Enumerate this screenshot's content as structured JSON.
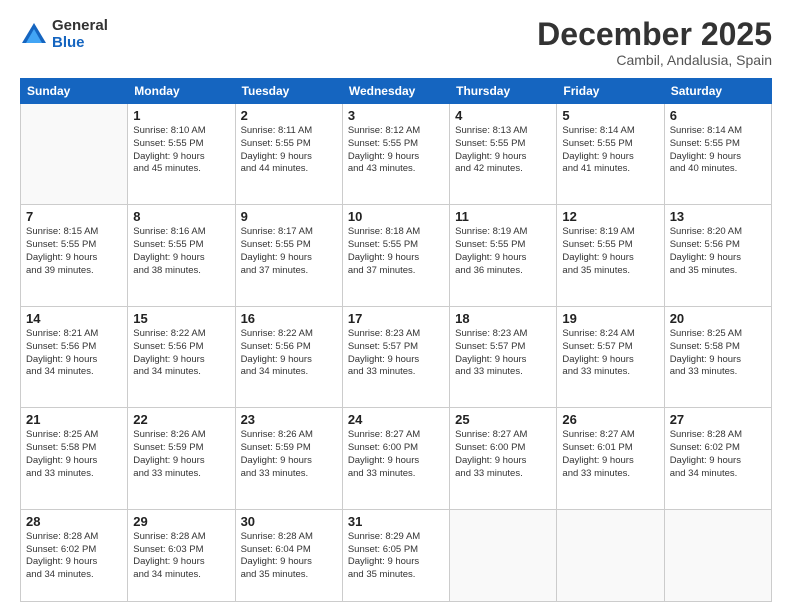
{
  "logo": {
    "general": "General",
    "blue": "Blue"
  },
  "header": {
    "month": "December 2025",
    "location": "Cambil, Andalusia, Spain"
  },
  "weekdays": [
    "Sunday",
    "Monday",
    "Tuesday",
    "Wednesday",
    "Thursday",
    "Friday",
    "Saturday"
  ],
  "weeks": [
    [
      {
        "day": null
      },
      {
        "day": "1",
        "sunrise": "Sunrise: 8:10 AM",
        "sunset": "Sunset: 5:55 PM",
        "daylight": "Daylight: 9 hours and 45 minutes."
      },
      {
        "day": "2",
        "sunrise": "Sunrise: 8:11 AM",
        "sunset": "Sunset: 5:55 PM",
        "daylight": "Daylight: 9 hours and 44 minutes."
      },
      {
        "day": "3",
        "sunrise": "Sunrise: 8:12 AM",
        "sunset": "Sunset: 5:55 PM",
        "daylight": "Daylight: 9 hours and 43 minutes."
      },
      {
        "day": "4",
        "sunrise": "Sunrise: 8:13 AM",
        "sunset": "Sunset: 5:55 PM",
        "daylight": "Daylight: 9 hours and 42 minutes."
      },
      {
        "day": "5",
        "sunrise": "Sunrise: 8:14 AM",
        "sunset": "Sunset: 5:55 PM",
        "daylight": "Daylight: 9 hours and 41 minutes."
      },
      {
        "day": "6",
        "sunrise": "Sunrise: 8:14 AM",
        "sunset": "Sunset: 5:55 PM",
        "daylight": "Daylight: 9 hours and 40 minutes."
      }
    ],
    [
      {
        "day": "7",
        "sunrise": "Sunrise: 8:15 AM",
        "sunset": "Sunset: 5:55 PM",
        "daylight": "Daylight: 9 hours and 39 minutes."
      },
      {
        "day": "8",
        "sunrise": "Sunrise: 8:16 AM",
        "sunset": "Sunset: 5:55 PM",
        "daylight": "Daylight: 9 hours and 38 minutes."
      },
      {
        "day": "9",
        "sunrise": "Sunrise: 8:17 AM",
        "sunset": "Sunset: 5:55 PM",
        "daylight": "Daylight: 9 hours and 37 minutes."
      },
      {
        "day": "10",
        "sunrise": "Sunrise: 8:18 AM",
        "sunset": "Sunset: 5:55 PM",
        "daylight": "Daylight: 9 hours and 37 minutes."
      },
      {
        "day": "11",
        "sunrise": "Sunrise: 8:19 AM",
        "sunset": "Sunset: 5:55 PM",
        "daylight": "Daylight: 9 hours and 36 minutes."
      },
      {
        "day": "12",
        "sunrise": "Sunrise: 8:19 AM",
        "sunset": "Sunset: 5:55 PM",
        "daylight": "Daylight: 9 hours and 35 minutes."
      },
      {
        "day": "13",
        "sunrise": "Sunrise: 8:20 AM",
        "sunset": "Sunset: 5:56 PM",
        "daylight": "Daylight: 9 hours and 35 minutes."
      }
    ],
    [
      {
        "day": "14",
        "sunrise": "Sunrise: 8:21 AM",
        "sunset": "Sunset: 5:56 PM",
        "daylight": "Daylight: 9 hours and 34 minutes."
      },
      {
        "day": "15",
        "sunrise": "Sunrise: 8:22 AM",
        "sunset": "Sunset: 5:56 PM",
        "daylight": "Daylight: 9 hours and 34 minutes."
      },
      {
        "day": "16",
        "sunrise": "Sunrise: 8:22 AM",
        "sunset": "Sunset: 5:56 PM",
        "daylight": "Daylight: 9 hours and 34 minutes."
      },
      {
        "day": "17",
        "sunrise": "Sunrise: 8:23 AM",
        "sunset": "Sunset: 5:57 PM",
        "daylight": "Daylight: 9 hours and 33 minutes."
      },
      {
        "day": "18",
        "sunrise": "Sunrise: 8:23 AM",
        "sunset": "Sunset: 5:57 PM",
        "daylight": "Daylight: 9 hours and 33 minutes."
      },
      {
        "day": "19",
        "sunrise": "Sunrise: 8:24 AM",
        "sunset": "Sunset: 5:57 PM",
        "daylight": "Daylight: 9 hours and 33 minutes."
      },
      {
        "day": "20",
        "sunrise": "Sunrise: 8:25 AM",
        "sunset": "Sunset: 5:58 PM",
        "daylight": "Daylight: 9 hours and 33 minutes."
      }
    ],
    [
      {
        "day": "21",
        "sunrise": "Sunrise: 8:25 AM",
        "sunset": "Sunset: 5:58 PM",
        "daylight": "Daylight: 9 hours and 33 minutes."
      },
      {
        "day": "22",
        "sunrise": "Sunrise: 8:26 AM",
        "sunset": "Sunset: 5:59 PM",
        "daylight": "Daylight: 9 hours and 33 minutes."
      },
      {
        "day": "23",
        "sunrise": "Sunrise: 8:26 AM",
        "sunset": "Sunset: 5:59 PM",
        "daylight": "Daylight: 9 hours and 33 minutes."
      },
      {
        "day": "24",
        "sunrise": "Sunrise: 8:27 AM",
        "sunset": "Sunset: 6:00 PM",
        "daylight": "Daylight: 9 hours and 33 minutes."
      },
      {
        "day": "25",
        "sunrise": "Sunrise: 8:27 AM",
        "sunset": "Sunset: 6:00 PM",
        "daylight": "Daylight: 9 hours and 33 minutes."
      },
      {
        "day": "26",
        "sunrise": "Sunrise: 8:27 AM",
        "sunset": "Sunset: 6:01 PM",
        "daylight": "Daylight: 9 hours and 33 minutes."
      },
      {
        "day": "27",
        "sunrise": "Sunrise: 8:28 AM",
        "sunset": "Sunset: 6:02 PM",
        "daylight": "Daylight: 9 hours and 34 minutes."
      }
    ],
    [
      {
        "day": "28",
        "sunrise": "Sunrise: 8:28 AM",
        "sunset": "Sunset: 6:02 PM",
        "daylight": "Daylight: 9 hours and 34 minutes."
      },
      {
        "day": "29",
        "sunrise": "Sunrise: 8:28 AM",
        "sunset": "Sunset: 6:03 PM",
        "daylight": "Daylight: 9 hours and 34 minutes."
      },
      {
        "day": "30",
        "sunrise": "Sunrise: 8:28 AM",
        "sunset": "Sunset: 6:04 PM",
        "daylight": "Daylight: 9 hours and 35 minutes."
      },
      {
        "day": "31",
        "sunrise": "Sunrise: 8:29 AM",
        "sunset": "Sunset: 6:05 PM",
        "daylight": "Daylight: 9 hours and 35 minutes."
      },
      {
        "day": null
      },
      {
        "day": null
      },
      {
        "day": null
      }
    ]
  ]
}
